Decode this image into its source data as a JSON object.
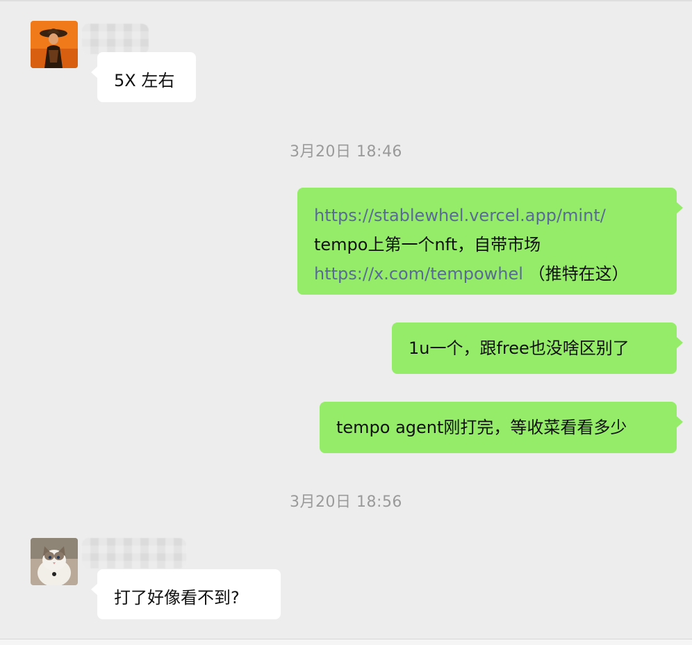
{
  "messages": {
    "m1": {
      "text": "5X 左右"
    },
    "m2": {
      "link1": "https://stablewhel.vercel.app/mint/",
      "line2": "tempo上第一个nft，自带市场",
      "link2": "https://x.com/tempowhel",
      "note": " （推特在这）"
    },
    "m3": {
      "text": "1u一个，跟free也没啥区别了"
    },
    "m4": {
      "text": "tempo agent刚打完，等收菜看看多少"
    },
    "m5": {
      "text": "打了好像看不到?"
    }
  },
  "timestamps": {
    "t1": "3月20日 18:46",
    "t2": "3月20日 18:56"
  },
  "colors": {
    "background": "#ededed",
    "incoming_bubble": "#ffffff",
    "outgoing_bubble": "#95ec69",
    "link": "#576b95",
    "timestamp": "#9a9a9a"
  },
  "icons": {
    "avatar1": "avatar-painted-figure-with-hat",
    "avatar2": "avatar-ragdoll-cat"
  }
}
